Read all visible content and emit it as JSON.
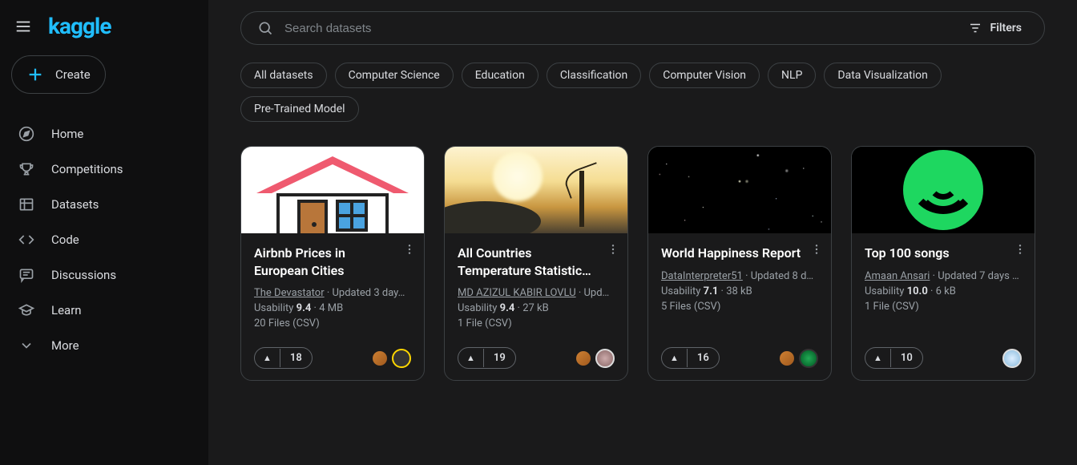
{
  "brand": "kaggle",
  "create_label": "Create",
  "search": {
    "placeholder": "Search datasets"
  },
  "filters_label": "Filters",
  "nav": [
    {
      "label": "Home"
    },
    {
      "label": "Competitions"
    },
    {
      "label": "Datasets"
    },
    {
      "label": "Code"
    },
    {
      "label": "Discussions"
    },
    {
      "label": "Learn"
    },
    {
      "label": "More"
    }
  ],
  "chips": [
    "All datasets",
    "Computer Science",
    "Education",
    "Classification",
    "Computer Vision",
    "NLP",
    "Data Visualization",
    "Pre-Trained Model"
  ],
  "cards": [
    {
      "title": "Airbnb Prices in European Cities",
      "author": "The Devastator",
      "updated": "Updated 3 day…",
      "usability_label": "Usability",
      "usability": "9.4",
      "size": "4 MB",
      "files": "20 Files (CSV)",
      "upvotes": "18"
    },
    {
      "title": "All Countries Temperature Statistic…",
      "author": "MD AZIZUL KABIR LOVLU",
      "updated": "Upd…",
      "usability_label": "Usability",
      "usability": "9.4",
      "size": "27 kB",
      "files": "1 File (CSV)",
      "upvotes": "19"
    },
    {
      "title": "World Happiness Report",
      "author": "DataInterpreter51",
      "updated": "Updated 8 d…",
      "usability_label": "Usability",
      "usability": "7.1",
      "size": "38 kB",
      "files": "5 Files (CSV)",
      "upvotes": "16"
    },
    {
      "title": "Top 100 songs",
      "author": "Amaan Ansari",
      "updated": "Updated 7 days …",
      "usability_label": "Usability",
      "usability": "10.0",
      "size": "6 kB",
      "files": "1 File (CSV)",
      "upvotes": "10"
    }
  ]
}
